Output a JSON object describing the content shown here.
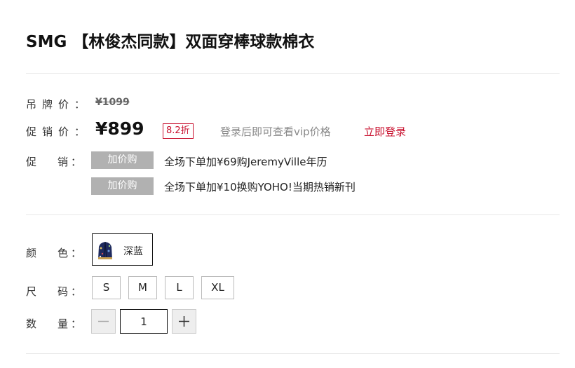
{
  "product": {
    "title": "SMG 【林俊杰同款】双面穿棒球款棉衣"
  },
  "price": {
    "tag_label_chars": [
      "吊",
      "牌",
      "价",
      "："
    ],
    "tag_price": "¥1099",
    "sale_label_chars": [
      "促",
      "销",
      "价",
      "："
    ],
    "sale_price": "¥899",
    "discount": "8.2折",
    "vip_note": "登录后即可查看vip价格",
    "login_link": "立即登录"
  },
  "promotion": {
    "label_chars": [
      "促",
      "销",
      "："
    ],
    "items": [
      {
        "tag": "加价购",
        "text": "全场下单加¥69购JeremyVille年历"
      },
      {
        "tag": "加价购",
        "text": "全场下单加¥10换购YOHO!当期热销新刊"
      }
    ]
  },
  "color": {
    "label_chars": [
      "颜",
      "色",
      "："
    ],
    "selected": "深蓝"
  },
  "size": {
    "label_chars": [
      "尺",
      "码",
      "："
    ],
    "options": [
      "S",
      "M",
      "L",
      "XL"
    ]
  },
  "quantity": {
    "label_chars": [
      "数",
      "量",
      "："
    ],
    "value": "1"
  },
  "colors": {
    "accent": "#c8102e",
    "promo_tag_bg": "#b1b1b1"
  }
}
